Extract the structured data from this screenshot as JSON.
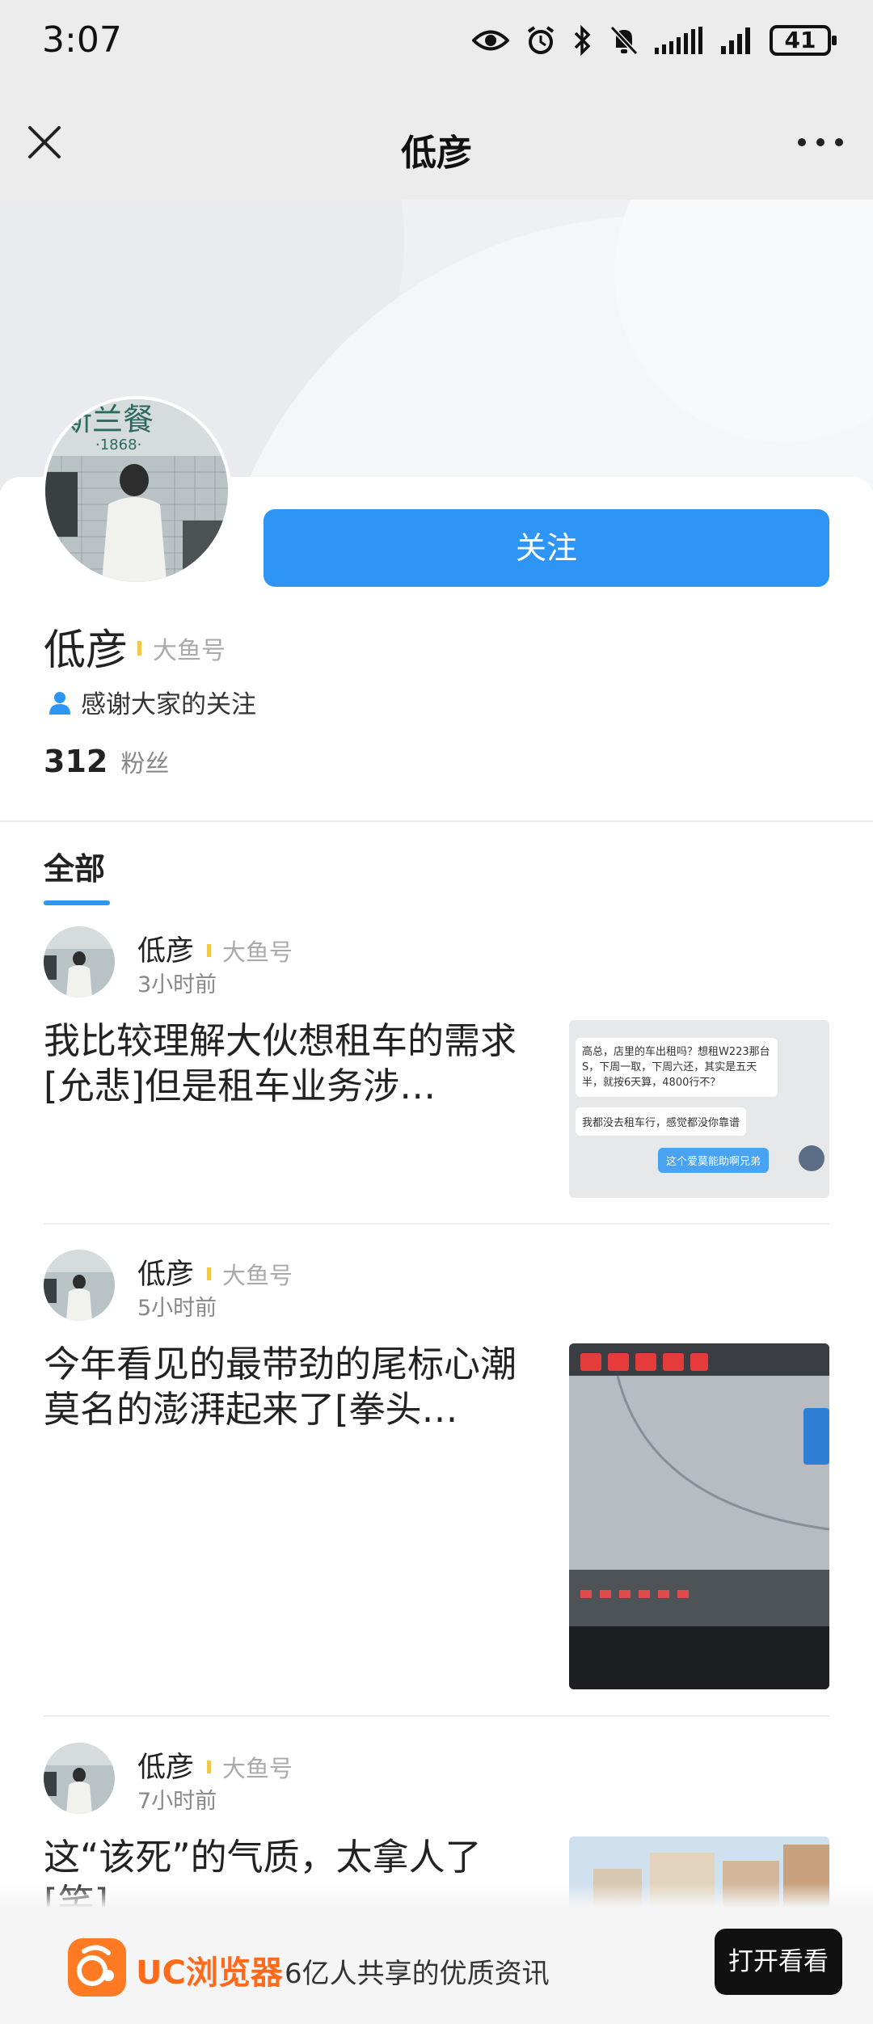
{
  "status_bar": {
    "time": "3:07",
    "battery": "41",
    "icons": [
      "eye-icon",
      "alarm-icon",
      "bluetooth-icon",
      "mute-icon",
      "signal-icon",
      "signal-icon",
      "battery-icon"
    ]
  },
  "nav": {
    "title": "低彦",
    "close_icon": "close-icon",
    "more_icon": "more-icon"
  },
  "profile": {
    "name": "低彦",
    "tag": "大鱼号",
    "follow_label": "关注",
    "bio": "感谢大家的关注",
    "fans_count": "312",
    "fans_label": "粉丝",
    "avatar_sign_top": "斯兰餐",
    "avatar_sign_year": "·1868·"
  },
  "tabs": [
    {
      "label": "全部",
      "active": true
    }
  ],
  "feed": [
    {
      "author": "低彦",
      "tag": "大鱼号",
      "time": "3小时前",
      "title": "我比较理解大伙想租车的需求[允悲]但是租车业务涉…",
      "thumb": {
        "bubble1": "高总，店里的车出租吗？想租W223那台S，下周一取，下周六还，其实是五天半，就按6天算，4800行不？",
        "bubble2": "我都没去租车行，感觉都没你靠谱",
        "bubble3": "这个爱莫能助啊兄弟"
      }
    },
    {
      "author": "低彦",
      "tag": "大鱼号",
      "time": "5小时前",
      "title": "今年看见的最带劲的尾标心潮莫名的澎湃起来了[拳头…"
    },
    {
      "author": "低彦",
      "tag": "大鱼号",
      "time": "7小时前",
      "title": "这“该死”的气质，太拿人了[笑]"
    }
  ],
  "bottom_banner": {
    "brand": "UC浏览器",
    "slogan": "6亿人共享的优质资讯",
    "open_label": "打开看看"
  },
  "colors": {
    "accent": "#2f95f5",
    "brand_orange": "#ff6a1a",
    "tag_yellow": "#f3c84a"
  }
}
